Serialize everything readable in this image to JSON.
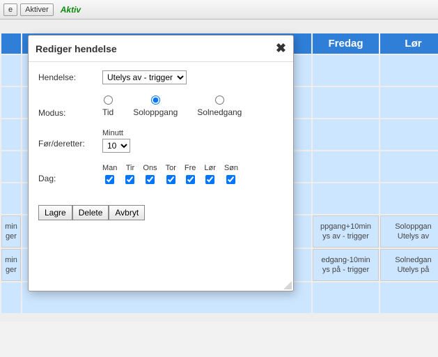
{
  "toolbar": {
    "btn_e_suffix": "e",
    "btn_aktiver": "Aktiver",
    "active_label": "Aktiv"
  },
  "schedule": {
    "headers": {
      "fredag": "Fredag",
      "lordag": "Lør"
    },
    "cells": {
      "c1_a_line1": "min",
      "c1_a_line2": "ger",
      "c1_b_line1": "min",
      "c1_b_line2": "ger",
      "fri_a_line1": "ppgang+10min",
      "fri_a_line2": "ys av - trigger",
      "fri_b_line1": "edgang-10min",
      "fri_b_line2": "ys på - trigger",
      "lor_a_line1": "Soloppgan",
      "lor_a_line2": "Utelys av",
      "lor_b_line1": "Solnedgan",
      "lor_b_line2": "Utelys på"
    }
  },
  "dialog": {
    "title": "Rediger hendelse",
    "labels": {
      "hendelse": "Hendelse:",
      "modus": "Modus:",
      "for_deretter": "Før/deretter:",
      "dag": "Dag:",
      "minutt": "Minutt"
    },
    "hendelse_select": {
      "selected": "Utelys av - trigger"
    },
    "modus": {
      "selected": "soloppgang",
      "options": {
        "tid": "Tid",
        "soloppgang": "Soloppgang",
        "solnedgang": "Solnedgang"
      }
    },
    "minutt_select": {
      "selected": "10"
    },
    "days": {
      "man": {
        "label": "Man",
        "checked": true
      },
      "tir": {
        "label": "Tir",
        "checked": true
      },
      "ons": {
        "label": "Ons",
        "checked": true
      },
      "tor": {
        "label": "Tor",
        "checked": true
      },
      "fre": {
        "label": "Fre",
        "checked": true
      },
      "lor": {
        "label": "Lør",
        "checked": true
      },
      "son": {
        "label": "Søn",
        "checked": true
      }
    },
    "buttons": {
      "lagre": "Lagre",
      "delete": "Delete",
      "avbryt": "Avbryt"
    }
  }
}
